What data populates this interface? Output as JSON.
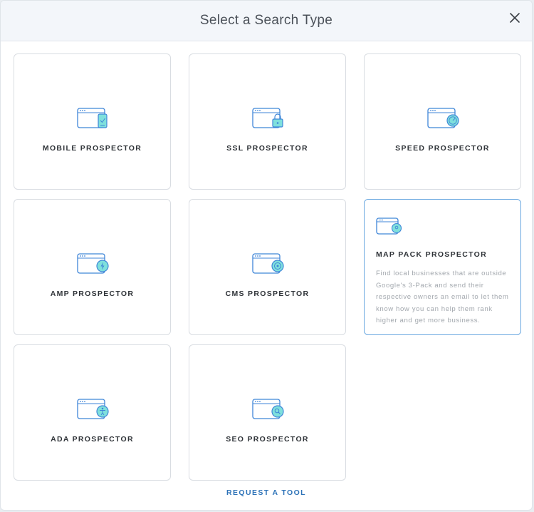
{
  "modal": {
    "title": "Select a Search Type"
  },
  "cards": [
    {
      "label": "MOBILE PROSPECTOR",
      "icon": "mobile-phone-icon"
    },
    {
      "label": "SSL PROSPECTOR",
      "icon": "padlock-icon"
    },
    {
      "label": "SPEED PROSPECTOR",
      "icon": "speedometer-icon"
    },
    {
      "label": "AMP PROSPECTOR",
      "icon": "lightning-icon"
    },
    {
      "label": "CMS PROSPECTOR",
      "icon": "cms-icon"
    },
    {
      "label": "MAP PACK PROSPECTOR",
      "icon": "map-pin-icon",
      "description": "Find local businesses that are outside Google's 3-Pack and send their respective owners an email to let them know how you can help them rank higher and get more business."
    },
    {
      "label": "ADA PROSPECTOR",
      "icon": "accessibility-icon"
    },
    {
      "label": "SEO PROSPECTOR",
      "icon": "search-icon"
    }
  ],
  "footer": {
    "request_label": "REQUEST A TOOL"
  },
  "colors": {
    "accent": "#2e73b8",
    "icon_outline": "#3f86d8",
    "icon_fill": "#7fe0dc",
    "selected_border": "#6aa8e0"
  }
}
